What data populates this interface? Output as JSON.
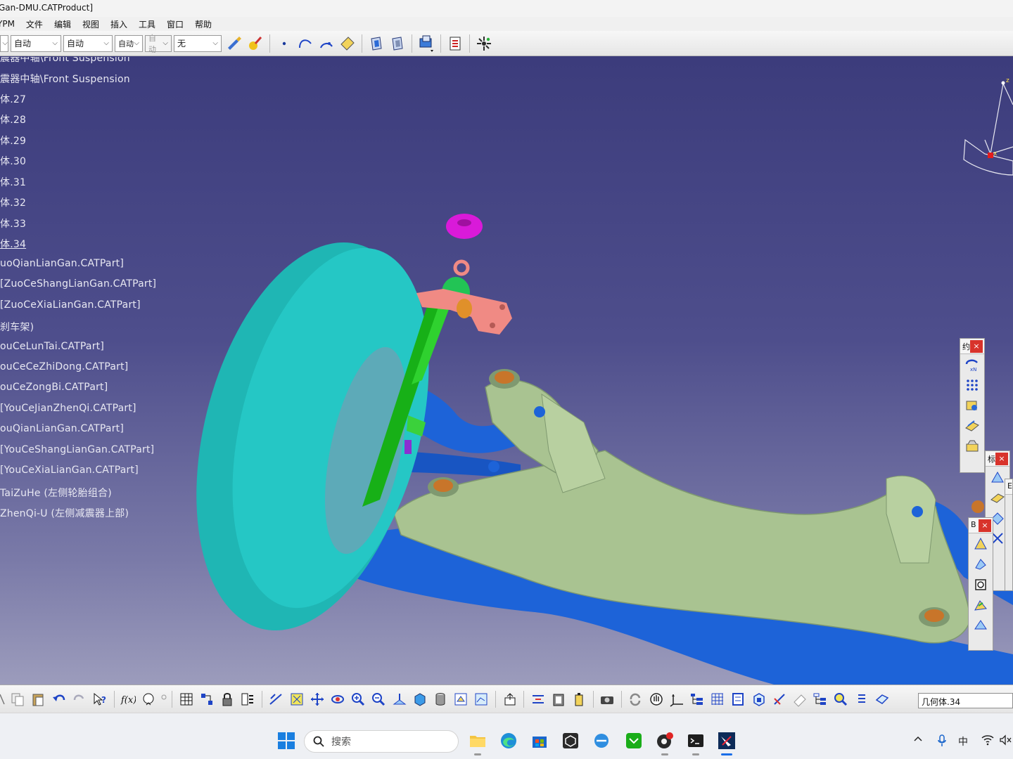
{
  "window": {
    "title": "Gan-DMU.CATProduct]"
  },
  "menu": [
    "YPM",
    "文件",
    "编辑",
    "视图",
    "插入",
    "工具",
    "窗口",
    "帮助"
  ],
  "toolbar": {
    "dropdowns": [
      {
        "value": "",
        "width": 12
      },
      {
        "value": "自动",
        "width": 72
      },
      {
        "value": "自动",
        "width": 70
      },
      {
        "value": "自动",
        "width": 40
      },
      {
        "value": "自动",
        "width": 38,
        "disabled": true
      },
      {
        "value": "无",
        "width": 68
      }
    ]
  },
  "tree": {
    "items": [
      {
        "label": "震器中轴\\Front Suspension",
        "clipped": true
      },
      {
        "label": "震器中轴\\Front Suspension"
      },
      {
        "label": "体.27"
      },
      {
        "label": "体.28"
      },
      {
        "label": "体.29"
      },
      {
        "label": "体.30"
      },
      {
        "label": "体.31"
      },
      {
        "label": "体.32"
      },
      {
        "label": "体.33"
      },
      {
        "label": "体.34",
        "current": true
      },
      {
        "label": "uoQianLianGan.CATPart]"
      },
      {
        "label": " [ZuoCeShangLianGan.CATPart]"
      },
      {
        "label": " [ZuoCeXiaLianGan.CATPart]"
      },
      {
        "label": "刹车架)"
      },
      {
        "label": "ouCeLunTai.CATPart]"
      },
      {
        "label": "ouCeCeZhiDong.CATPart]"
      },
      {
        "label": "ouCeZongBi.CATPart]"
      },
      {
        "label": " [YouCeJianZhenQi.CATPart]"
      },
      {
        "label": "ouQianLianGan.CATPart]"
      },
      {
        "label": " [YouCeShangLianGan.CATPart]"
      },
      {
        "label": " [YouCeXiaLianGan.CATPart]"
      },
      {
        "label": "TaiZuHe (左侧轮胎组合)"
      },
      {
        "label": "ZhenQi-U (左侧减震器上部)"
      }
    ]
  },
  "compass": {
    "axis_z": "z",
    "axis_x": "x"
  },
  "palettes": [
    {
      "title": "约",
      "close": "×"
    },
    {
      "title": "标",
      "close": "×"
    },
    {
      "title": "E",
      "close": "×"
    },
    {
      "title": "B",
      "close": "×"
    }
  ],
  "command_field": {
    "value": "几何体.34"
  },
  "taskbar": {
    "search_placeholder": "搜索",
    "ime": "中"
  },
  "colors": {
    "viewport_top": "#3c3c7c",
    "tire": "#21c4c2",
    "subframe": "#a9c391",
    "control_arm": "#1d63d8",
    "strut": "#17b017",
    "bracket": "#f08a84",
    "bushing": "#d91ad9"
  }
}
